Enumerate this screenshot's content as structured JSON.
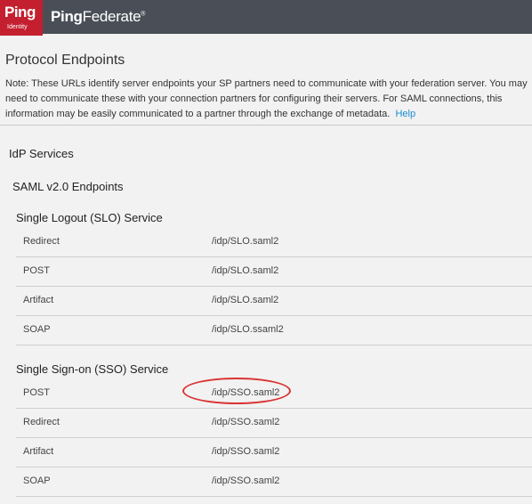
{
  "header": {
    "logo_text": "Ping",
    "logo_subtext": "Identity",
    "product_bold": "Ping",
    "product_rest": "Federate",
    "product_tm": "®"
  },
  "page": {
    "title": "Protocol Endpoints",
    "note": "Note:  These URLs identify server endpoints your SP partners need to communicate with your federation server. You may need to communicate these with your connection partners for configuring their servers. For SAML connections, this information may be easily communicated to a partner through the exchange of metadata.",
    "help_link": "Help"
  },
  "sections": {
    "idp_services": "IdP Services",
    "saml_endpoints": "SAML v2.0 Endpoints",
    "slo": {
      "title": "Single Logout (SLO) Service",
      "rows": [
        {
          "binding": "Redirect",
          "path": "/idp/SLO.saml2"
        },
        {
          "binding": "POST",
          "path": "/idp/SLO.saml2"
        },
        {
          "binding": "Artifact",
          "path": "/idp/SLO.saml2"
        },
        {
          "binding": "SOAP",
          "path": "/idp/SLO.ssaml2"
        }
      ]
    },
    "sso": {
      "title": "Single Sign-on (SSO) Service",
      "rows": [
        {
          "binding": "POST",
          "path": "/idp/SSO.saml2"
        },
        {
          "binding": "Redirect",
          "path": "/idp/SSO.saml2"
        },
        {
          "binding": "Artifact",
          "path": "/idp/SSO.saml2"
        },
        {
          "binding": "SOAP",
          "path": "/idp/SSO.saml2"
        }
      ]
    }
  },
  "colors": {
    "header_bg": "#4a4f57",
    "logo_red": "#c41f2e",
    "link_blue": "#1a8bd1",
    "highlight_red": "#d93433"
  }
}
